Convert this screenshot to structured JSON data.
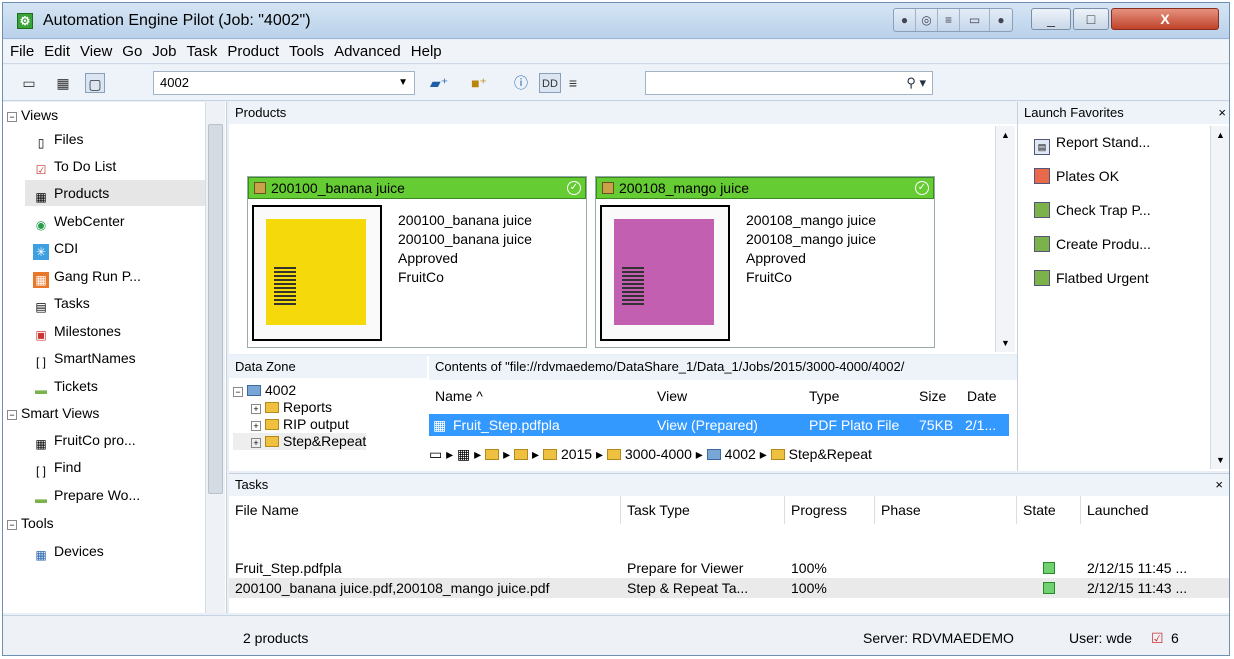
{
  "window": {
    "title": "Automation Engine Pilot (Job: \"4002\")"
  },
  "menu": [
    "File",
    "Edit",
    "View",
    "Go",
    "Job",
    "Task",
    "Product",
    "Tools",
    "Advanced",
    "Help"
  ],
  "toolbar": {
    "job": "4002",
    "search_value": ""
  },
  "sidebar": {
    "views_label": "Views",
    "views": [
      {
        "label": "Files",
        "icon": "file-icon"
      },
      {
        "label": "To Do List",
        "icon": "todo-icon"
      },
      {
        "label": "Products",
        "icon": "grid-icon"
      },
      {
        "label": "WebCenter",
        "icon": "webcenter-icon"
      },
      {
        "label": "CDI",
        "icon": "cdi-icon"
      },
      {
        "label": "Gang Run P...",
        "icon": "gang-run-icon"
      },
      {
        "label": "Tasks",
        "icon": "tasks-icon"
      },
      {
        "label": "Milestones",
        "icon": "milestones-icon"
      },
      {
        "label": "SmartNames",
        "icon": "smartnames-icon"
      },
      {
        "label": "Tickets",
        "icon": "tickets-icon"
      }
    ],
    "smart_views_label": "Smart Views",
    "smart_views": [
      {
        "label": "FruitCo pro...",
        "icon": "grid-icon"
      },
      {
        "label": "Find",
        "icon": "find-icon"
      },
      {
        "label": "Prepare Wo...",
        "icon": "tickets-icon"
      }
    ],
    "tools_label": "Tools",
    "tools": [
      {
        "label": "Devices",
        "icon": "devices-icon"
      }
    ]
  },
  "products": {
    "header": "Products",
    "cards": [
      {
        "title": "200100_banana juice",
        "lines": [
          "200100_banana juice",
          "200100_banana juice",
          "Approved",
          "FruitCo"
        ],
        "color": "#f5d90a"
      },
      {
        "title": "200108_mango juice",
        "lines": [
          "200108_mango juice",
          "200108_mango juice",
          "Approved",
          "FruitCo"
        ],
        "color": "#c35fb0"
      }
    ]
  },
  "favorites": {
    "header": "Launch Favorites",
    "items": [
      "Report Stand...",
      "Plates OK",
      "Check Trap P...",
      "Create Produ...",
      "Flatbed Urgent"
    ]
  },
  "datazone": {
    "header": "Data Zone",
    "contents_label": "Contents of \"file://rdvmaedemo/DataShare_1/Data_1/Jobs/2015/3000-4000/4002/",
    "tree_root": "4002",
    "tree": [
      "Reports",
      "RIP output",
      "Step&Repeat"
    ],
    "columns": {
      "name": "Name ^",
      "view": "View",
      "type": "Type",
      "size": "Size",
      "date": "Date"
    },
    "file": {
      "name": "Fruit_Step.pdfpla",
      "view": "View (Prepared)",
      "type": "PDF Plato File",
      "size": "75KB",
      "date": "2/1..."
    },
    "breadcrumb": [
      "2015",
      "3000-4000",
      "4002",
      "Step&Repeat"
    ]
  },
  "tasks": {
    "header": "Tasks",
    "columns": [
      "File Name",
      "Task Type",
      "Progress",
      "Phase",
      "State",
      "Launched"
    ],
    "rows": [
      {
        "file": "Fruit_Step.pdfpla",
        "type": "Prepare for Viewer",
        "progress": "100%",
        "phase": "",
        "launched": "2/12/15 11:45 ..."
      },
      {
        "file": "200100_banana juice.pdf,200108_mango juice.pdf",
        "type": "Step & Repeat Ta...",
        "progress": "100%",
        "phase": "",
        "launched": "2/12/15 11:43 ..."
      }
    ]
  },
  "status": {
    "count": "2 products",
    "server": "Server: RDVMAEDEMO",
    "user": "User: wde",
    "todo": "6"
  }
}
